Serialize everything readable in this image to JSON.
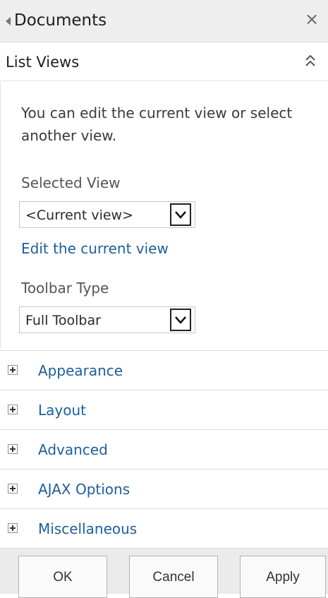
{
  "panel": {
    "title": "Documents",
    "close_glyph": "×"
  },
  "list_views": {
    "title": "List Views",
    "intro": "You can edit the current view or select another view.",
    "selected_view": {
      "label": "Selected View",
      "value": "<Current view>"
    },
    "edit_link": "Edit the current view",
    "toolbar_type": {
      "label": "Toolbar Type",
      "value": "Full Toolbar"
    }
  },
  "sections": [
    {
      "label": "Appearance"
    },
    {
      "label": "Layout"
    },
    {
      "label": "Advanced"
    },
    {
      "label": "AJAX Options"
    },
    {
      "label": "Miscellaneous"
    }
  ],
  "buttons": {
    "ok": "OK",
    "cancel": "Cancel",
    "apply": "Apply"
  },
  "colors": {
    "link": "#1d5e9c",
    "title_bar_bg": "#eeeeee",
    "footer_bg": "#ebebeb"
  },
  "icons": {
    "back": "back-arrow-icon",
    "close": "close-icon",
    "collapse": "double-chevron-up-icon",
    "dropdown": "chevron-down-icon",
    "expand": "plus-box-icon"
  }
}
